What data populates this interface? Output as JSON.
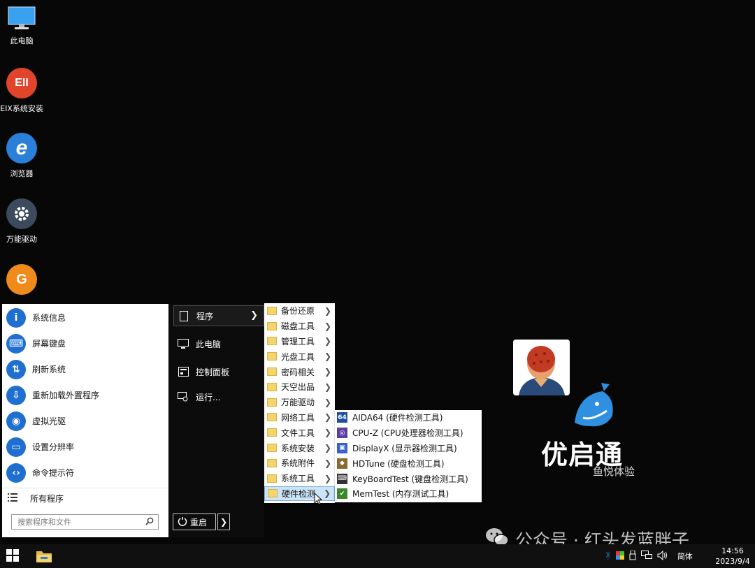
{
  "desktop_icons": [
    {
      "label": "此电脑",
      "icon": "monitor-icon"
    },
    {
      "label": "EIX系统安装",
      "icon": "eix-icon",
      "glyph": "EII"
    },
    {
      "label": "浏览器",
      "icon": "ie-browser-icon",
      "glyph": "e"
    },
    {
      "label": "万能驱动",
      "icon": "gear-icon"
    },
    {
      "label": "",
      "icon": "g-app-icon",
      "glyph": "G"
    }
  ],
  "start_menu": {
    "left_items": [
      {
        "label": "系统信息",
        "icon": "info-icon",
        "glyph": "i"
      },
      {
        "label": "屏幕键盘",
        "icon": "keyboard-icon",
        "glyph": "⌨"
      },
      {
        "label": "刷新系统",
        "icon": "refresh-icon",
        "glyph": "⇅"
      },
      {
        "label": "重新加载外置程序",
        "icon": "reload-icon",
        "glyph": "⇩"
      },
      {
        "label": "虚拟光驱",
        "icon": "disc-icon",
        "glyph": "◉"
      },
      {
        "label": "设置分辨率",
        "icon": "display-icon",
        "glyph": "▭"
      },
      {
        "label": "命令提示符",
        "icon": "code-icon",
        "glyph": "‹›"
      }
    ],
    "all_programs": "所有程序",
    "search_placeholder": "搜索程序和文件",
    "middle_items": [
      {
        "label": "程序",
        "icon": "document-icon"
      },
      {
        "label": "此电脑",
        "icon": "computer-icon"
      },
      {
        "label": "控制面板",
        "icon": "control-panel-icon"
      },
      {
        "label": "运行...",
        "icon": "run-icon"
      }
    ],
    "restart_label": "重启"
  },
  "programs_submenu": [
    {
      "label": "备份还原"
    },
    {
      "label": "磁盘工具"
    },
    {
      "label": "管理工具"
    },
    {
      "label": "光盘工具"
    },
    {
      "label": "密码相关"
    },
    {
      "label": "天空出品"
    },
    {
      "label": "万能驱动"
    },
    {
      "label": "网络工具"
    },
    {
      "label": "文件工具"
    },
    {
      "label": "系统安装"
    },
    {
      "label": "系统附件"
    },
    {
      "label": "系统工具"
    },
    {
      "label": "硬件检测",
      "active": true
    }
  ],
  "hardware_submenu": [
    {
      "label": "AIDA64 (硬件检测工具)",
      "icon": "aida64-icon",
      "glyph": "64",
      "color": "#1d4fa0"
    },
    {
      "label": "CPU-Z (CPU处理器检测工具)",
      "icon": "cpuz-icon",
      "glyph": "◎",
      "color": "#5a3fa0"
    },
    {
      "label": "DisplayX (显示器检测工具)",
      "icon": "displayx-icon",
      "glyph": "▣",
      "color": "#3a5fd0"
    },
    {
      "label": "HDTune (硬盘检测工具)",
      "icon": "hdtune-icon",
      "glyph": "◆",
      "color": "#8a6a30"
    },
    {
      "label": "KeyBoardTest (键盘检测工具)",
      "icon": "keyboard-test-icon",
      "glyph": "⌨",
      "color": "#333333"
    },
    {
      "label": "MemTest (内存测试工具)",
      "icon": "memtest-icon",
      "glyph": "✔",
      "color": "#3a8a2a"
    }
  ],
  "branding": {
    "name": "优启通",
    "subtitle": "鱼悦体验",
    "accent": "#2f8fe0"
  },
  "watermark": {
    "text": "公众号 · 红头发蓝胖子",
    "icon": "wechat-icon"
  },
  "taskbar": {
    "tray_icons": [
      "bluetooth-icon",
      "color-flag-icon",
      "usb-icon",
      "network-icon",
      "volume-icon"
    ],
    "ime_label": "简体",
    "time": "14:56",
    "date": "2023/9/4"
  }
}
